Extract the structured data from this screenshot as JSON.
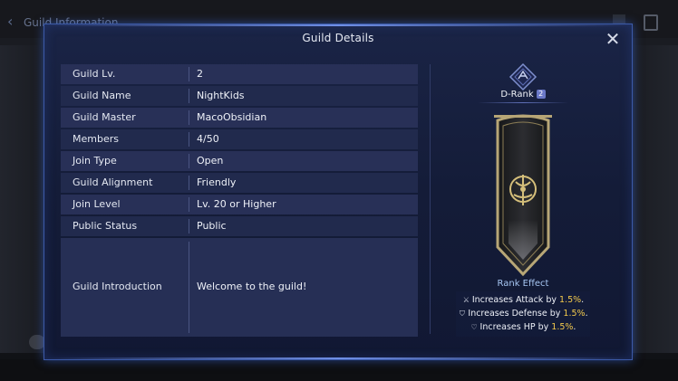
{
  "background": {
    "screen_title": "Guild Information"
  },
  "modal": {
    "title": "Guild Details",
    "close_label": "✕"
  },
  "info_rows": [
    {
      "label": "Guild Lv.",
      "value": "2"
    },
    {
      "label": "Guild Name",
      "value": "NightKids"
    },
    {
      "label": "Guild Master",
      "value": "MacoObsidian"
    },
    {
      "label": "Members",
      "value": "4/50"
    },
    {
      "label": "Join Type",
      "value": "Open"
    },
    {
      "label": "Guild Alignment",
      "value": "Friendly"
    },
    {
      "label": "Join Level",
      "value": "Lv. 20 or Higher"
    },
    {
      "label": "Public Status",
      "value": "Public"
    },
    {
      "label": "Guild Introduction",
      "value": "Welcome to the  guild!"
    }
  ],
  "rank": {
    "name": "D-Rank",
    "number": "2",
    "effect_title": "Rank Effect",
    "effects": [
      {
        "icon": "sword-icon",
        "prefix": "Increases Attack by ",
        "value": "1.5%",
        "suffix": "."
      },
      {
        "icon": "shield-icon",
        "prefix": "Increases Defense by ",
        "value": "1.5%",
        "suffix": "."
      },
      {
        "icon": "heart-icon",
        "prefix": "Increases HP by ",
        "value": "1.5%",
        "suffix": "."
      }
    ]
  },
  "colors": {
    "highlight": "#f2c94c",
    "modal_border": "#3c5aa8",
    "rank_effect_title": "#a6c6f2"
  }
}
